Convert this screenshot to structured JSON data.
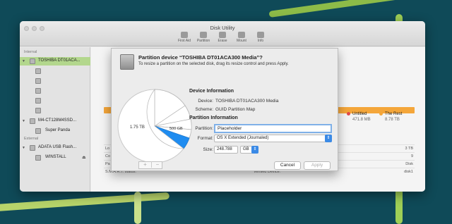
{
  "window": {
    "title": "Disk Utility"
  },
  "toolbar": [
    {
      "label": "First Aid",
      "icon": "first-aid-icon"
    },
    {
      "label": "Partition",
      "icon": "partition-icon"
    },
    {
      "label": "Erase",
      "icon": "erase-icon"
    },
    {
      "label": "Mount",
      "icon": "mount-icon"
    },
    {
      "label": "Info",
      "icon": "info-icon"
    }
  ],
  "sidebar": {
    "internal_heading": "Internal",
    "external_heading": "External",
    "disk1": "TOSHIBA DT01ACA...",
    "disk2": "M4-CT128M4SSD...",
    "disk2_volume": "Super Panda",
    "disk3": "ADATA USB Flash...",
    "disk3_volume": "WINSTALL",
    "eject_glyph": "⏏"
  },
  "main": {
    "legend": [
      {
        "label": "Untitled",
        "value": "471.8 MB",
        "color": "#e24a4a"
      },
      {
        "label": "The Rest",
        "value": "8.78 TB",
        "color": "#f4a63a"
      }
    ],
    "rows": [
      {
        "left": "Lo",
        "right": "3 TB"
      },
      {
        "left": "Co",
        "right": "9"
      },
      {
        "left": "Pa",
        "right": "Disk"
      },
      {
        "left": "S.M.A.R.T. status:",
        "mid": "Verified  Device:",
        "right": "disk1"
      }
    ]
  },
  "sheet": {
    "heading": "Partition device “TOSHIBA DT01ACA300 Media”?",
    "subheading": "To resize a partition on the selected disk, drag its resize control and press Apply.",
    "device_info_title": "Device Information",
    "device_label": "Device:",
    "device_value": "TOSHIBA DT01ACA300 Media",
    "scheme_label": "Scheme:",
    "scheme_value": "GUID Partition Map",
    "partition_info_title": "Partition Information",
    "partition_label": "Partition:",
    "partition_value": "Placeholder",
    "format_label": "Format:",
    "format_value": "OS X Extended (Journaled)",
    "size_label": "Size:",
    "size_value": "248.788",
    "size_unit": "GB",
    "pie_large_label": "1.75 TB",
    "pie_mid_label": "500 GB",
    "add_glyph": "+",
    "remove_glyph": "−",
    "cancel_label": "Cancel",
    "apply_label": "Apply"
  }
}
